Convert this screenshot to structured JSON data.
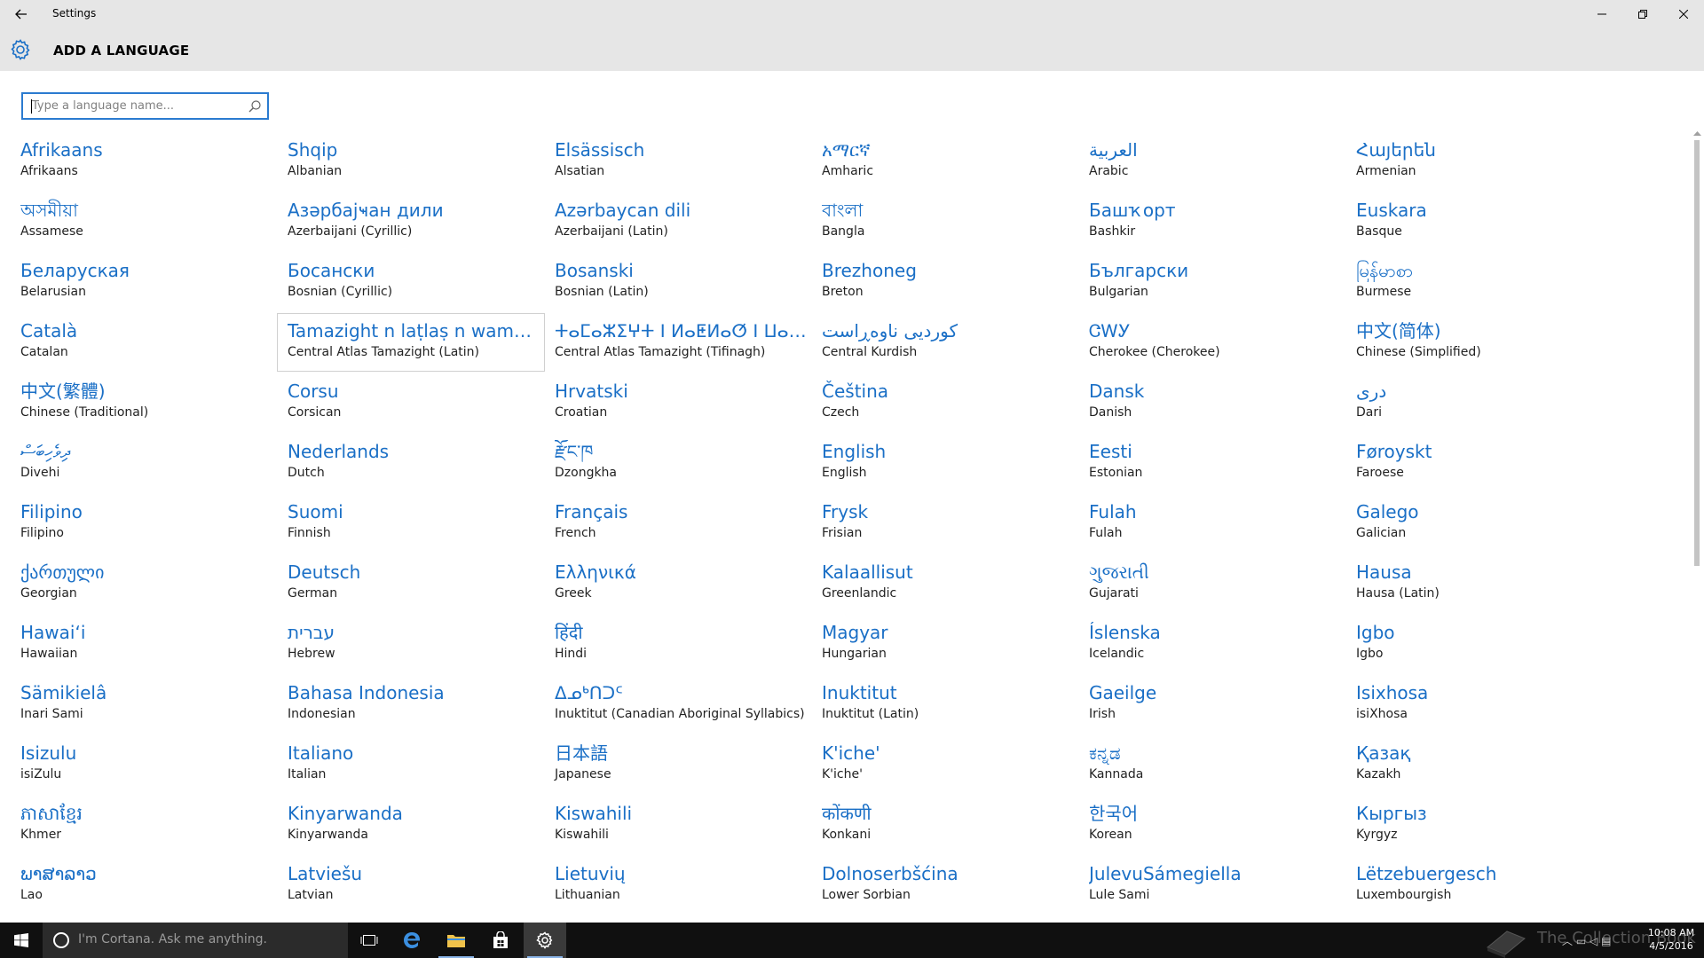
{
  "window": {
    "title": "Settings"
  },
  "header": {
    "page_title": "ADD A LANGUAGE"
  },
  "search": {
    "placeholder": "Type a language name..."
  },
  "languages": [
    {
      "native": "Afrikaans",
      "english": "Afrikaans"
    },
    {
      "native": "Shqip",
      "english": "Albanian"
    },
    {
      "native": "Elsässisch",
      "english": "Alsatian"
    },
    {
      "native": "አማርኛ",
      "english": "Amharic"
    },
    {
      "native": "العربية",
      "english": "Arabic"
    },
    {
      "native": "Հայերեն",
      "english": "Armenian"
    },
    {
      "native": "অসমীয়া",
      "english": "Assamese"
    },
    {
      "native": "Азәрбајҹан дили",
      "english": "Azerbaijani (Cyrillic)"
    },
    {
      "native": "Azərbaycan dili",
      "english": "Azerbaijani (Latin)"
    },
    {
      "native": "বাংলা",
      "english": "Bangla"
    },
    {
      "native": "Башҡорт",
      "english": "Bashkir"
    },
    {
      "native": "Euskara",
      "english": "Basque"
    },
    {
      "native": "Беларуская",
      "english": "Belarusian"
    },
    {
      "native": "Босански",
      "english": "Bosnian (Cyrillic)"
    },
    {
      "native": "Bosanski",
      "english": "Bosnian (Latin)"
    },
    {
      "native": "Brezhoneg",
      "english": "Breton"
    },
    {
      "native": "Български",
      "english": "Bulgarian"
    },
    {
      "native": "မြန်မာစာ",
      "english": "Burmese"
    },
    {
      "native": "Català",
      "english": "Catalan"
    },
    {
      "native": "Tamazight n laṭlaṣ n wamm...",
      "english": "Central Atlas Tamazight (Latin)"
    },
    {
      "native": "ⵜⴰⵎⴰⵣⵉⵖⵜ ⵏ ⵍⴰⵟⵍⴰⵚ ⵏ ⵡⴰⵎⵎⴰⵙ",
      "english": "Central Atlas Tamazight (Tifinagh)"
    },
    {
      "native": "کوردیی ناوەڕاست",
      "english": "Central Kurdish"
    },
    {
      "native": "ᏣᎳᎩ",
      "english": "Cherokee (Cherokee)"
    },
    {
      "native": "中文(简体)",
      "english": "Chinese (Simplified)"
    },
    {
      "native": "中文(繁體)",
      "english": "Chinese (Traditional)"
    },
    {
      "native": "Corsu",
      "english": "Corsican"
    },
    {
      "native": "Hrvatski",
      "english": "Croatian"
    },
    {
      "native": "Čeština",
      "english": "Czech"
    },
    {
      "native": "Dansk",
      "english": "Danish"
    },
    {
      "native": "دری",
      "english": "Dari"
    },
    {
      "native": "ދިވެހިބަސް",
      "english": "Divehi"
    },
    {
      "native": "Nederlands",
      "english": "Dutch"
    },
    {
      "native": "རྫོང་ཁ",
      "english": "Dzongkha"
    },
    {
      "native": "English",
      "english": "English"
    },
    {
      "native": "Eesti",
      "english": "Estonian"
    },
    {
      "native": "Føroyskt",
      "english": "Faroese"
    },
    {
      "native": "Filipino",
      "english": "Filipino"
    },
    {
      "native": "Suomi",
      "english": "Finnish"
    },
    {
      "native": "Français",
      "english": "French"
    },
    {
      "native": "Frysk",
      "english": "Frisian"
    },
    {
      "native": "Fulah",
      "english": "Fulah"
    },
    {
      "native": "Galego",
      "english": "Galician"
    },
    {
      "native": "ქართული",
      "english": "Georgian"
    },
    {
      "native": "Deutsch",
      "english": "German"
    },
    {
      "native": "Ελληνικά",
      "english": "Greek"
    },
    {
      "native": "Kalaallisut",
      "english": "Greenlandic"
    },
    {
      "native": "ગુજરાતી",
      "english": "Gujarati"
    },
    {
      "native": "Hausa",
      "english": "Hausa (Latin)"
    },
    {
      "native": "Hawaiʻi",
      "english": "Hawaiian"
    },
    {
      "native": "עברית",
      "english": "Hebrew"
    },
    {
      "native": "हिंदी",
      "english": "Hindi"
    },
    {
      "native": "Magyar",
      "english": "Hungarian"
    },
    {
      "native": "Íslenska",
      "english": "Icelandic"
    },
    {
      "native": "Igbo",
      "english": "Igbo"
    },
    {
      "native": "Sämikielâ",
      "english": "Inari Sami"
    },
    {
      "native": "Bahasa Indonesia",
      "english": "Indonesian"
    },
    {
      "native": "ᐃᓄᒃᑎᑐᑦ",
      "english": "Inuktitut (Canadian Aboriginal Syllabics)"
    },
    {
      "native": "Inuktitut",
      "english": "Inuktitut (Latin)"
    },
    {
      "native": "Gaeilge",
      "english": "Irish"
    },
    {
      "native": "Isixhosa",
      "english": "isiXhosa"
    },
    {
      "native": "Isizulu",
      "english": "isiZulu"
    },
    {
      "native": "Italiano",
      "english": "Italian"
    },
    {
      "native": "日本語",
      "english": "Japanese"
    },
    {
      "native": "K'iche'",
      "english": "K'iche'"
    },
    {
      "native": "ಕನ್ನಡ",
      "english": "Kannada"
    },
    {
      "native": "Қазақ",
      "english": "Kazakh"
    },
    {
      "native": "ភាសាខ្មែរ",
      "english": "Khmer"
    },
    {
      "native": "Kinyarwanda",
      "english": "Kinyarwanda"
    },
    {
      "native": "Kiswahili",
      "english": "Kiswahili"
    },
    {
      "native": "कोंकणी",
      "english": "Konkani"
    },
    {
      "native": "한국어",
      "english": "Korean"
    },
    {
      "native": "Кыргыз",
      "english": "Kyrgyz"
    },
    {
      "native": "ພາສາລາວ",
      "english": "Lao"
    },
    {
      "native": "Latviešu",
      "english": "Latvian"
    },
    {
      "native": "Lietuvių",
      "english": "Lithuanian"
    },
    {
      "native": "Dolnoserbšćina",
      "english": "Lower Sorbian"
    },
    {
      "native": "JulevuSámegiella",
      "english": "Lule Sami"
    },
    {
      "native": "Lëtzebuergesch",
      "english": "Luxembourgish"
    }
  ],
  "taskbar": {
    "cortana_text": "I'm Cortana. Ask me anything.",
    "watermark": "The Collection Book",
    "time": "10:08 AM",
    "date": "4/5/2016"
  },
  "colors": {
    "accent": "#1a6fc6",
    "titlebar_bg": "#e6e6e6",
    "taskbar_bg": "#101010"
  }
}
